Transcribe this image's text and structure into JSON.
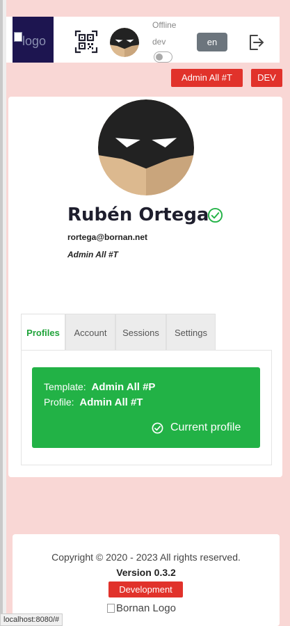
{
  "header": {
    "logo_alt": "logo",
    "connection_status": "Offline",
    "env_toggle_label": "dev",
    "language_button": "en"
  },
  "badges": {
    "profile": "Admin All #T",
    "environment": "DEV"
  },
  "user": {
    "name": "Rubén Ortega",
    "email": "rortega@bornan.net",
    "role": "Admin All #T"
  },
  "tabs": [
    {
      "label": "Profiles",
      "active": true
    },
    {
      "label": "Account",
      "active": false
    },
    {
      "label": "Sessions",
      "active": false
    },
    {
      "label": "Settings",
      "active": false
    }
  ],
  "profile_panel": {
    "template_label": "Template:",
    "template_value": "Admin All #P",
    "profile_label": "Profile:",
    "profile_value": "Admin All #T",
    "current_label": "Current profile"
  },
  "footer": {
    "copyright": "Copyright © 2020 - 2023 All rights reserved.",
    "version": "Version 0.3.2",
    "environment": "Development",
    "logo_alt": "Bornan Logo"
  },
  "status_bar_url": "localhost:8080/#",
  "colors": {
    "page_bg": "#f9d7d5",
    "brand_dark": "#1d1550",
    "danger": "#e1322b",
    "success": "#22b246",
    "tab_active": "#20a33a",
    "secondary": "#6c757d"
  }
}
